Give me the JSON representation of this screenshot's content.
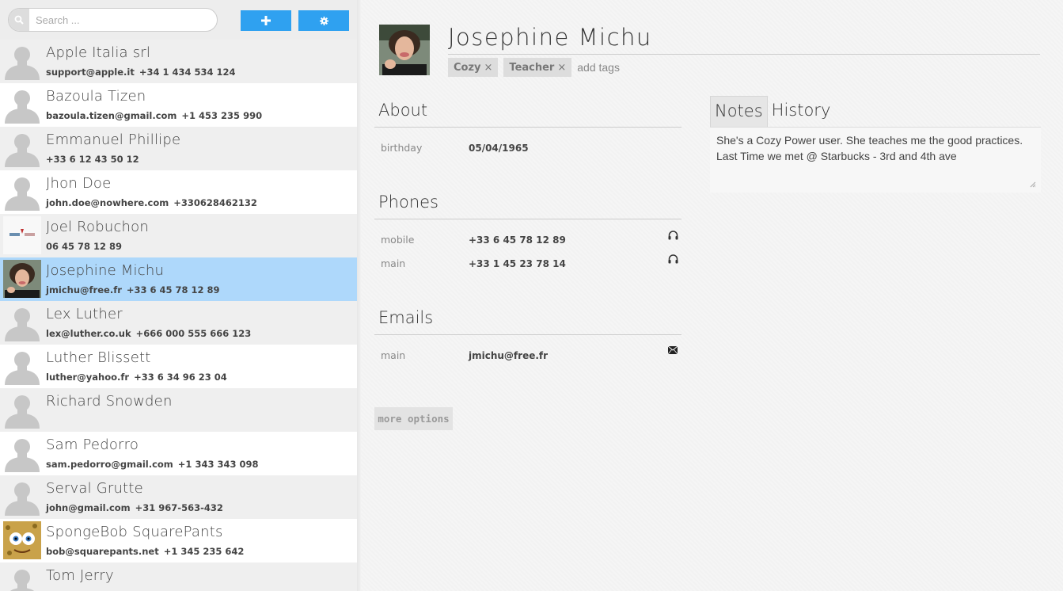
{
  "search": {
    "placeholder": "Search ..."
  },
  "toolbar": {
    "add_icon": "plus-icon",
    "settings_icon": "gear-icon"
  },
  "contacts": [
    {
      "name": "Apple Italia srl",
      "email": "support@apple.it",
      "phone": "+34 1 434 534 124",
      "avatar": "default"
    },
    {
      "name": "Bazoula Tizen",
      "email": "bazoula.tizen@gmail.com",
      "phone": "+1 453 235 990",
      "avatar": "default"
    },
    {
      "name": "Emmanuel Phillipe",
      "email": "",
      "phone": "+33 6 12 43 50 12",
      "avatar": "default"
    },
    {
      "name": "Jhon Doe",
      "email": "john.doe@nowhere.com",
      "phone": "+330628462132",
      "avatar": "default"
    },
    {
      "name": "Joel Robuchon",
      "email": "",
      "phone": "06 45 78 12 89",
      "avatar": "logo"
    },
    {
      "name": "Josephine Michu",
      "email": "jmichu@free.fr",
      "phone": "+33 6 45 78 12 89",
      "avatar": "photo",
      "selected": true
    },
    {
      "name": "Lex Luther",
      "email": "lex@luther.co.uk",
      "phone": "+666 000 555 666 123",
      "avatar": "default"
    },
    {
      "name": "Luther Blissett",
      "email": "luther@yahoo.fr",
      "phone": "+33 6 34 96 23 04",
      "avatar": "default"
    },
    {
      "name": "Richard Snowden",
      "email": "",
      "phone": "",
      "avatar": "default"
    },
    {
      "name": "Sam Pedorro",
      "email": "sam.pedorro@gmail.com",
      "phone": "+1 343 343 098",
      "avatar": "default"
    },
    {
      "name": "Serval Grutte",
      "email": "john@gmail.com",
      "phone": "+31 967-563-432",
      "avatar": "default"
    },
    {
      "name": "SpongeBob SquarePants",
      "email": "bob@squarepants.net",
      "phone": "+1 345 235 642",
      "avatar": "sponge"
    },
    {
      "name": "Tom Jerry",
      "email": "",
      "phone": "",
      "avatar": "default"
    }
  ],
  "profile": {
    "name": "Josephine Michu",
    "tags": [
      "Cozy",
      "Teacher"
    ],
    "tag_remove": "×",
    "tag_placeholder": "add tags"
  },
  "about": {
    "title": "About",
    "fields": [
      {
        "label": "birthday",
        "value": "05/04/1965"
      }
    ]
  },
  "phones": {
    "title": "Phones",
    "fields": [
      {
        "label": "mobile",
        "value": "+33 6 45 78 12 89",
        "icon": "headphones-icon"
      },
      {
        "label": "main",
        "value": "+33 1 45 23 78 14",
        "icon": "headphones-icon"
      }
    ]
  },
  "emails": {
    "title": "Emails",
    "fields": [
      {
        "label": "main",
        "value": "jmichu@free.fr",
        "icon": "envelope-icon"
      }
    ]
  },
  "more_options": "more options",
  "notes": {
    "tabs": [
      "Notes",
      "History"
    ],
    "active_tab": "Notes",
    "text_line1": "She's a Cozy Power user. She teaches me the good practices.",
    "text_line2": "Last Time we met @ Starbucks - 3rd and 4th ave"
  },
  "colors": {
    "accent": "#2fa1f0",
    "selected_row": "#aed8fb",
    "alt_row": "#efefef"
  }
}
